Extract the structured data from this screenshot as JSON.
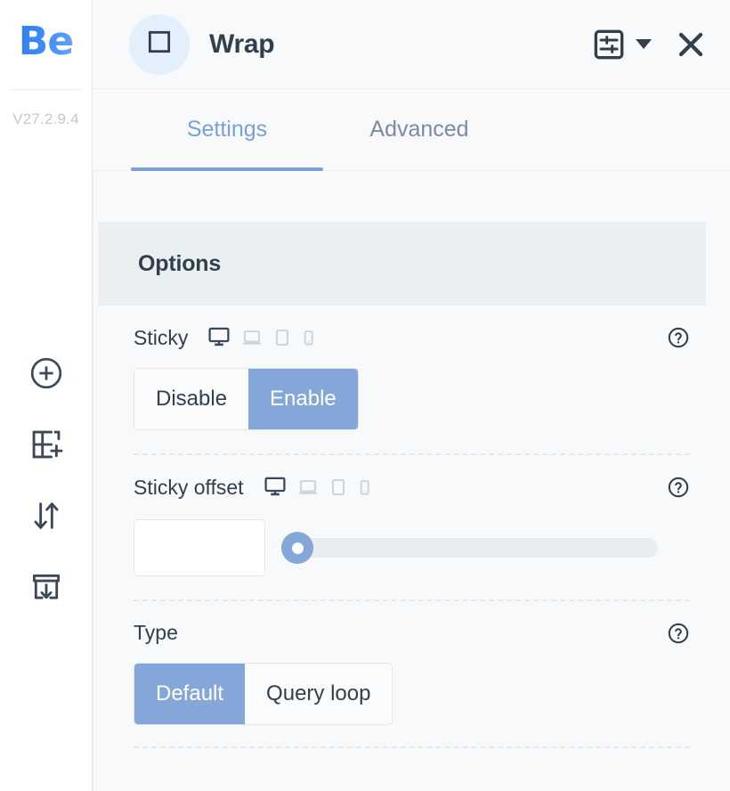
{
  "rail": {
    "logo_text": "Be",
    "version": "V27.2.9.4",
    "icons": [
      {
        "name": "add-circle-icon",
        "label": "Add"
      },
      {
        "name": "add-layout-icon",
        "label": "Add layout"
      },
      {
        "name": "sort-arrows-icon",
        "label": "Reorder"
      },
      {
        "name": "import-box-icon",
        "label": "Import"
      }
    ]
  },
  "header": {
    "title": "Wrap",
    "badge_icon": "square-icon",
    "settings_icon": "sliders-icon",
    "dropdown_icon": "caret-down-icon",
    "close_icon": "close-icon"
  },
  "tabs": [
    {
      "label": "Settings",
      "active": true
    },
    {
      "label": "Advanced",
      "active": false
    }
  ],
  "section": {
    "title": "Options"
  },
  "devices": [
    {
      "name": "desktop",
      "active": true
    },
    {
      "name": "laptop",
      "active": false
    },
    {
      "name": "tablet",
      "active": false
    },
    {
      "name": "mobile",
      "active": false
    }
  ],
  "fields": {
    "sticky": {
      "label": "Sticky",
      "help_icon": "help-circle-icon",
      "options": [
        "Disable",
        "Enable"
      ],
      "selected": "Enable"
    },
    "sticky_offset": {
      "label": "Sticky offset",
      "help_icon": "help-circle-icon",
      "value": "",
      "placeholder": "",
      "slider_percent": 0
    },
    "type": {
      "label": "Type",
      "help_icon": "help-circle-icon",
      "options": [
        "Default",
        "Query loop"
      ],
      "selected": "Default"
    }
  },
  "colors": {
    "accent": "#85a6d8",
    "tab_active": "#7ba0d6",
    "text_dark": "#32404e",
    "band_bg": "#eaf0f2",
    "panel_bg": "#f7f9fa",
    "logo_blue": "#3d8bf7"
  }
}
